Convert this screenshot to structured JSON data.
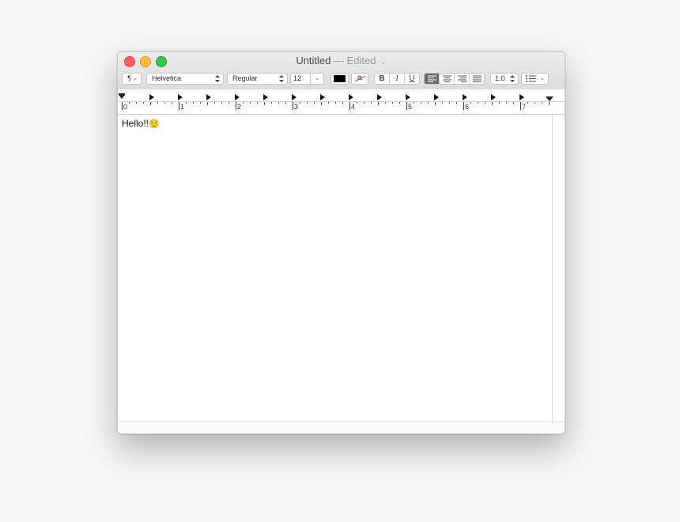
{
  "window": {
    "title": "Untitled",
    "separator": "—",
    "status": "Edited",
    "status_chevron": "⌄"
  },
  "toolbar": {
    "paragraph_style": "¶",
    "font_family": "Helvetica",
    "font_style": "Regular",
    "font_size": "12",
    "bold_label": "B",
    "italic_label": "I",
    "underline_label": "U",
    "text_color": "#000000",
    "background_color_glyph": "a",
    "line_spacing": "1.0",
    "alignment": "left"
  },
  "ruler": {
    "numbers": [
      "0",
      "1",
      "2",
      "3",
      "4",
      "5",
      "6",
      "7"
    ]
  },
  "document": {
    "text": "Hello!!",
    "emoji": "😌"
  }
}
